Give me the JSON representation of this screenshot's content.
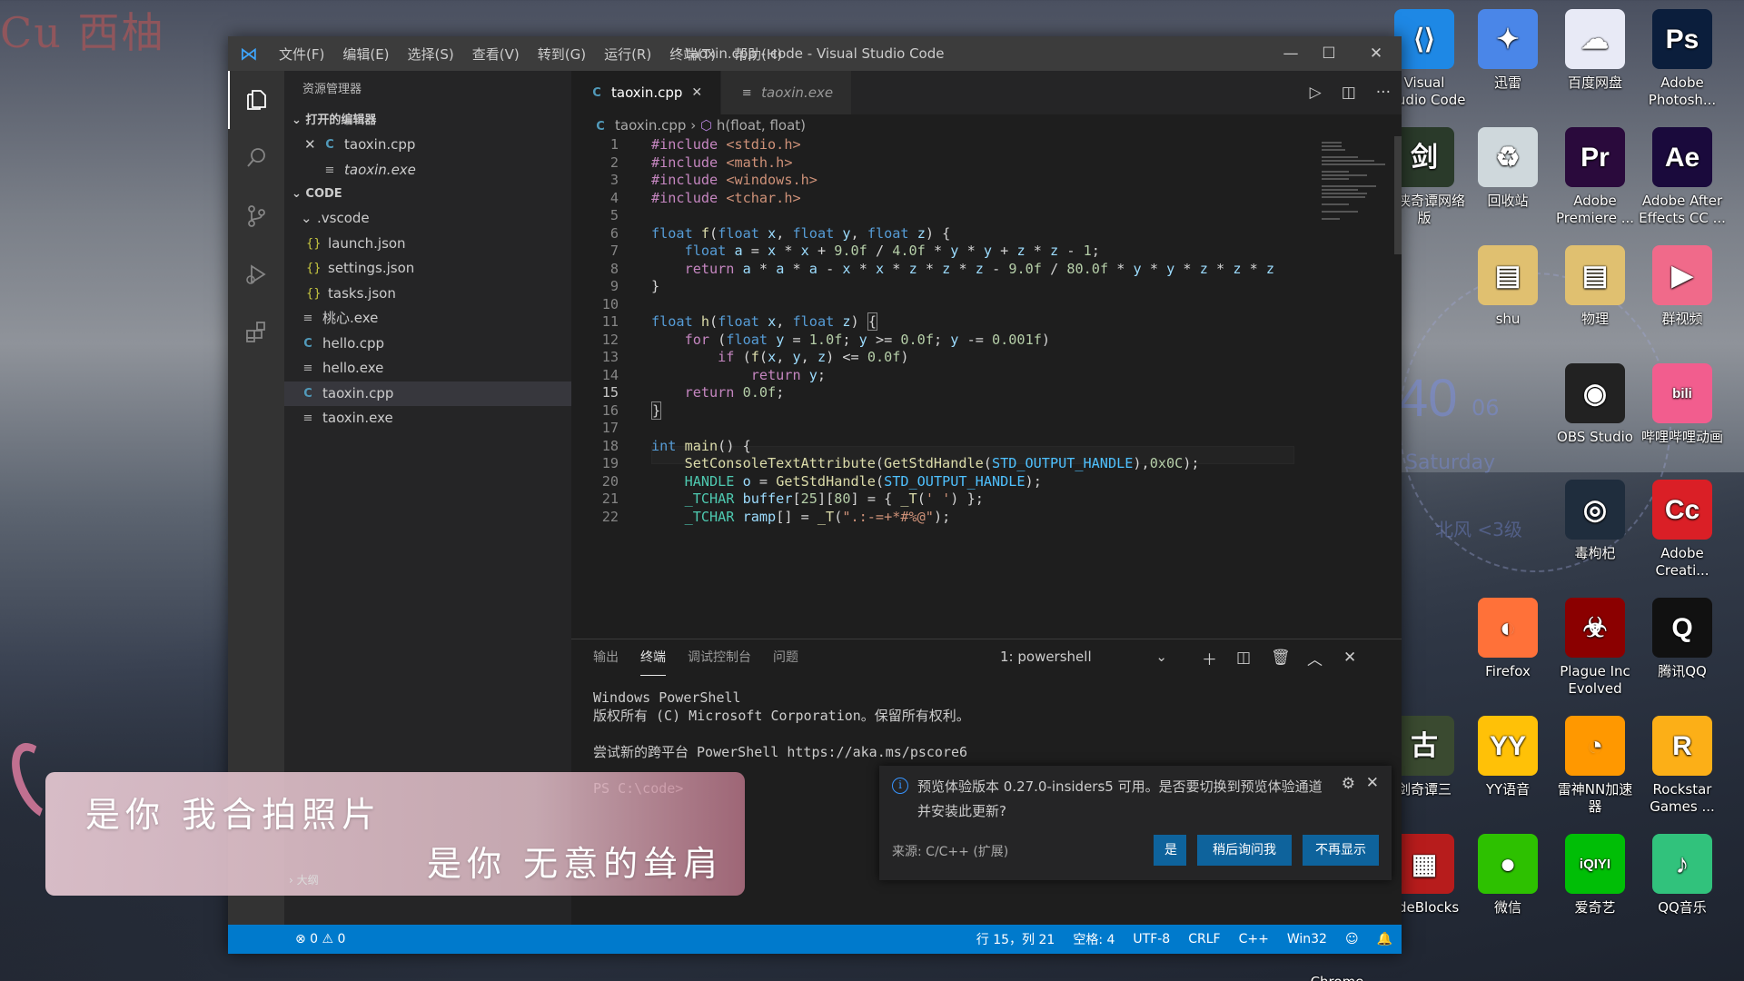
{
  "desktop": {
    "watermark": "Cu 西柚",
    "clock": {
      "time": "40",
      "seconds": "06",
      "day": "Saturday",
      "weather": "北风 <3级"
    },
    "icons": [
      {
        "label": "Visual Studio Code",
        "glyph": "⟨⟩",
        "color": "#1e88e5"
      },
      {
        "label": "迅雷",
        "glyph": "✦",
        "color": "#4a86e8"
      },
      {
        "label": "百度网盘",
        "glyph": "☁",
        "color": "#e8eaf6"
      },
      {
        "label": "Adobe Photosh...",
        "glyph": "Ps",
        "color": "#0b1e3c"
      },
      {
        "label": "剑侠奇谭网络版",
        "glyph": "剑",
        "color": "#2a3a2a"
      },
      {
        "label": "回收站",
        "glyph": "♻",
        "color": "#cfd8dc"
      },
      {
        "label": "Adobe Premiere ...",
        "glyph": "Pr",
        "color": "#2a0a3c"
      },
      {
        "label": "Adobe After Effects CC ...",
        "glyph": "Ae",
        "color": "#1a0a3c"
      },
      {
        "label": "shu",
        "glyph": "▤",
        "color": "#e0c070"
      },
      {
        "label": "物理",
        "glyph": "▤",
        "color": "#e0c070"
      },
      {
        "label": "群视频",
        "glyph": "▶",
        "color": "#f06a8a"
      },
      {
        "label": "OBS Studio",
        "glyph": "◉",
        "color": "#222"
      },
      {
        "label": "哔哩哔哩动画",
        "glyph": "bili",
        "color": "#f25d8e"
      },
      {
        "label": "毒枸杞",
        "glyph": "◎",
        "color": "#1f2d3d"
      },
      {
        "label": "Adobe Creati...",
        "glyph": "Cc",
        "color": "#da1f26"
      },
      {
        "label": "Firefox",
        "glyph": "◐",
        "color": "#ff7139"
      },
      {
        "label": "Plague Inc Evolved",
        "glyph": "☣",
        "color": "#8b0000"
      },
      {
        "label": "腾讯QQ",
        "glyph": "Q",
        "color": "#111"
      },
      {
        "label": "剑奇谭三",
        "glyph": "古",
        "color": "#3a4a30"
      },
      {
        "label": "YY语音",
        "glyph": "YY",
        "color": "#ffc107"
      },
      {
        "label": "雷神NN加速器",
        "glyph": "◔",
        "color": "#ff9800"
      },
      {
        "label": "Rockstar Games ...",
        "glyph": "R",
        "color": "#fcaf17"
      },
      {
        "label": "odeBlocks",
        "glyph": "▦",
        "color": "#b71c1c"
      },
      {
        "label": "微信",
        "glyph": "●",
        "color": "#2dc100"
      },
      {
        "label": "爱奇艺",
        "glyph": "iQIYI",
        "color": "#00be06"
      },
      {
        "label": "QQ音乐",
        "glyph": "♪",
        "color": "#31c27c"
      },
      {
        "label": "Chrome",
        "glyph": "",
        "color": "transparent"
      }
    ]
  },
  "window": {
    "title": "taoxin.cpp - code - Visual Studio Code",
    "menu": [
      "文件(F)",
      "编辑(E)",
      "选择(S)",
      "查看(V)",
      "转到(G)",
      "运行(R)",
      "终端(T)",
      "帮助(H)"
    ]
  },
  "sidebar": {
    "header": "资源管理器",
    "open_editors": {
      "title": "打开的编辑器",
      "items": [
        "taoxin.cpp",
        "taoxin.exe"
      ]
    },
    "folder": {
      "title": "CODE",
      "subfolder": ".vscode",
      "sub_items": [
        "launch.json",
        "settings.json",
        "tasks.json"
      ],
      "items": [
        "桃心.exe",
        "hello.cpp",
        "hello.exe",
        "taoxin.cpp",
        "taoxin.exe"
      ]
    }
  },
  "editor": {
    "tabs": [
      "taoxin.cpp",
      "taoxin.exe"
    ],
    "breadcrumb": {
      "file": "taoxin.cpp",
      "symbol": "h(float, float)"
    },
    "line_numbers": [
      "1",
      "2",
      "3",
      "4",
      "5",
      "6",
      "7",
      "8",
      "9",
      "10",
      "11",
      "12",
      "13",
      "14",
      "15",
      "16",
      "17",
      "18",
      "19",
      "20",
      "21",
      "22"
    ]
  },
  "panel": {
    "tabs": [
      "输出",
      "终端",
      "调试控制台",
      "问题"
    ],
    "shell": "1: powershell",
    "terminal": "Windows PowerShell\n版权所有 (C) Microsoft Corporation。保留所有权利。\n\n尝试新的跨平台 PowerShell https://aka.ms/pscore6\n\nPS C:\\code>"
  },
  "statusbar": {
    "problems": "⊗ 0 ⚠ 0",
    "position": "行 15，列 21",
    "spaces": "空格: 4",
    "encoding": "UTF-8",
    "eol": "CRLF",
    "language": "C++",
    "platform": "Win32"
  },
  "notification": {
    "message": "预览体验版本 0.27.0-insiders5 可用。是否要切换到预览体验通道并安装此更新?",
    "source": "来源: C/C++ (扩展)",
    "buttons": [
      "是",
      "稍后询问我",
      "不再显示"
    ]
  },
  "lyrics": {
    "line1": "是你 我合拍照片",
    "line2": "是你 无意的耸肩",
    "outline": "大纲"
  }
}
